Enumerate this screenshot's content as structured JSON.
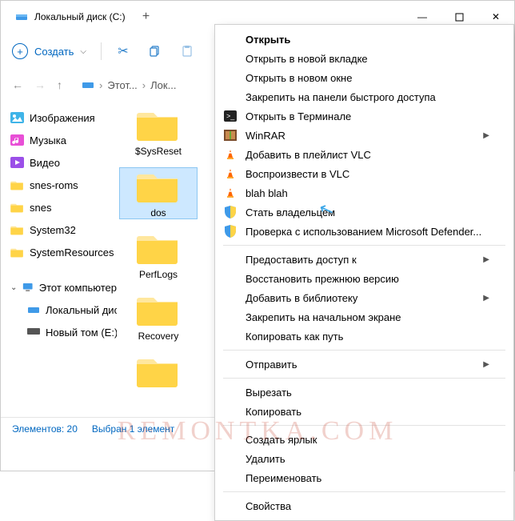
{
  "title": "Локальный диск (C:)",
  "toolbar": {
    "new_label": "Создать"
  },
  "breadcrumb": {
    "seg1": "Этот...",
    "seg2": "Лок..."
  },
  "sidebar": {
    "items": [
      {
        "label": "Изображения"
      },
      {
        "label": "Музыка"
      },
      {
        "label": "Видео"
      },
      {
        "label": "snes-roms"
      },
      {
        "label": "snes"
      },
      {
        "label": "System32"
      },
      {
        "label": "SystemResources"
      }
    ],
    "tree_root": "Этот компьютер",
    "tree_children": [
      {
        "label": "Локальный диск"
      },
      {
        "label": "Новый том (E:)"
      }
    ]
  },
  "content": {
    "items": [
      {
        "name": "$SysReset"
      },
      {
        "name": "dos"
      },
      {
        "name": "PerfLogs"
      },
      {
        "name": "Recovery"
      }
    ],
    "selected_index": 1
  },
  "status": {
    "count": "Элементов: 20",
    "selection": "Выбран 1 элемент"
  },
  "context_menu": {
    "groups": [
      [
        {
          "label": "Открыть",
          "bold": true
        },
        {
          "label": "Открыть в новой вкладке"
        },
        {
          "label": "Открыть в новом окне"
        },
        {
          "label": "Закрепить на панели быстрого доступа"
        },
        {
          "label": "Открыть в Терминале",
          "icon": "terminal"
        },
        {
          "label": "WinRAR",
          "icon": "winrar",
          "submenu": true
        },
        {
          "label": "Добавить в плейлист VLC",
          "icon": "vlc"
        },
        {
          "label": "Воспроизвести в VLC",
          "icon": "vlc"
        },
        {
          "label": "blah blah",
          "icon": "vlc"
        },
        {
          "label": "Стать владельцем",
          "icon": "shield"
        },
        {
          "label": "Проверка с использованием Microsoft Defender...",
          "icon": "shield"
        }
      ],
      [
        {
          "label": "Предоставить доступ к",
          "submenu": true
        },
        {
          "label": "Восстановить прежнюю версию"
        },
        {
          "label": "Добавить в библиотеку",
          "submenu": true
        },
        {
          "label": "Закрепить на начальном экране"
        },
        {
          "label": "Копировать как путь"
        }
      ],
      [
        {
          "label": "Отправить",
          "submenu": true
        }
      ],
      [
        {
          "label": "Вырезать"
        },
        {
          "label": "Копировать"
        }
      ],
      [
        {
          "label": "Создать ярлык"
        },
        {
          "label": "Удалить"
        },
        {
          "label": "Переименовать"
        }
      ],
      [
        {
          "label": "Свойства"
        }
      ]
    ]
  },
  "watermark": "REMONTKA.COM"
}
